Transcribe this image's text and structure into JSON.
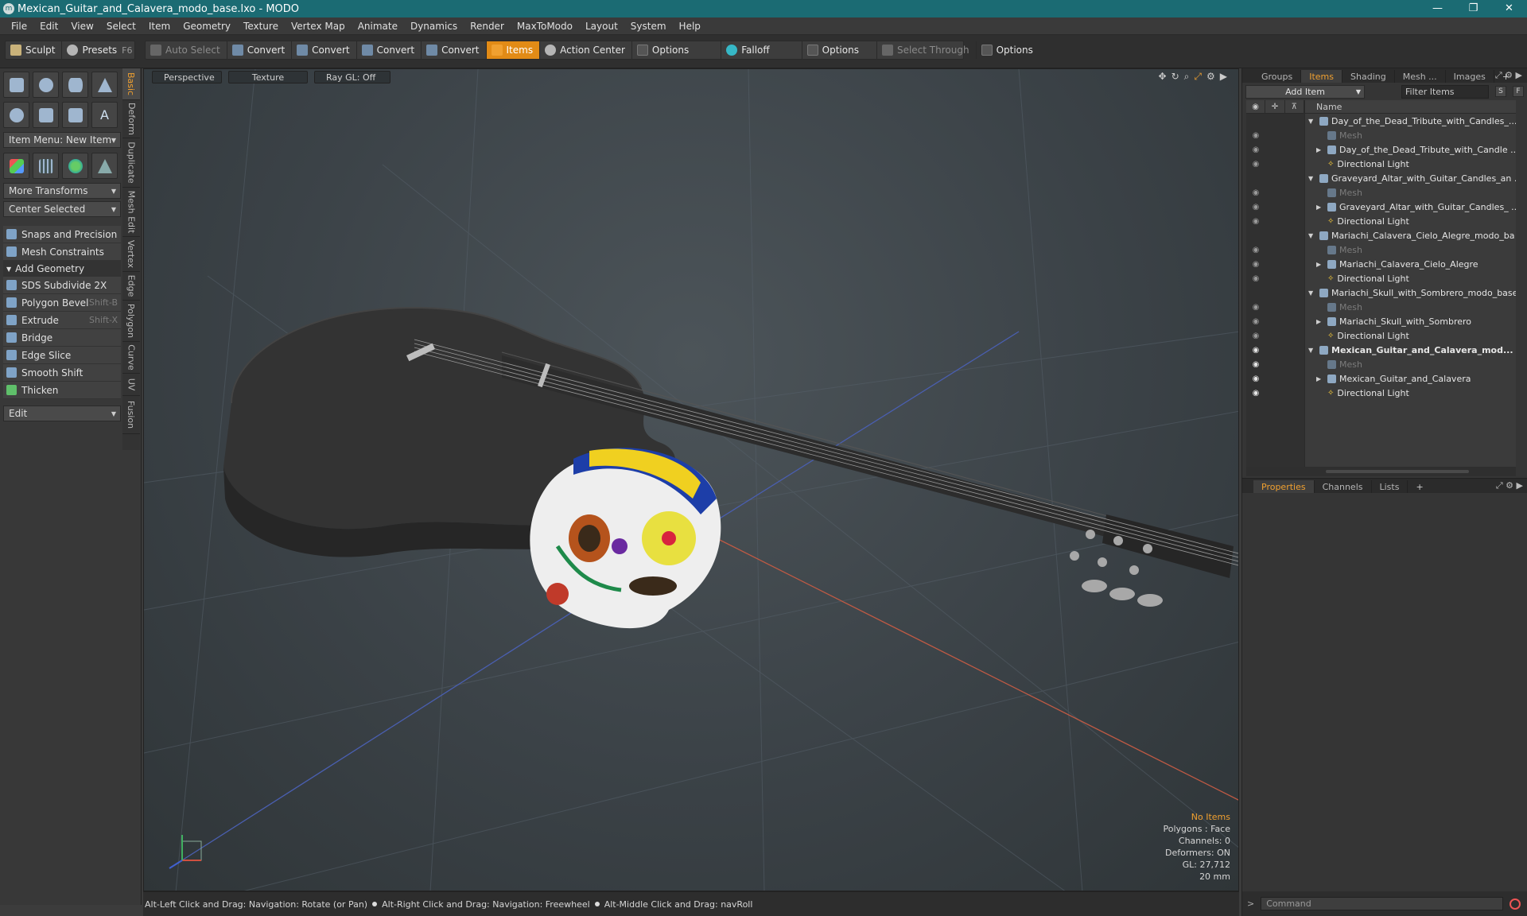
{
  "window": {
    "title": "Mexican_Guitar_and_Calavera_modo_base.lxo - MODO",
    "minimize": "—",
    "maximize": "❐",
    "close": "✕"
  },
  "menu": [
    "File",
    "Edit",
    "View",
    "Select",
    "Item",
    "Geometry",
    "Texture",
    "Vertex Map",
    "Animate",
    "Dynamics",
    "Render",
    "MaxToModo",
    "Layout",
    "System",
    "Help"
  ],
  "toolbar": {
    "sculpt": "Sculpt",
    "presets": "Presets",
    "presets_key": "F6",
    "auto_select": "Auto Select",
    "convert": [
      "Convert",
      "Convert",
      "Convert",
      "Convert"
    ],
    "items": "Items",
    "action_center": "Action Center",
    "options": [
      "Options",
      "Options",
      "Options"
    ],
    "falloff": "Falloff",
    "select_through": "Select Through"
  },
  "left": {
    "item_menu": "Item Menu: New Item",
    "more_transforms": "More Transforms",
    "center_selected": "Center Selected",
    "snaps": "Snaps and Precision",
    "mesh_constraints": "Mesh Constraints",
    "add_geometry": "Add Geometry",
    "tools": [
      {
        "label": "SDS Subdivide 2X",
        "key": ""
      },
      {
        "label": "Polygon Bevel",
        "key": "Shift-B"
      },
      {
        "label": "Extrude",
        "key": "Shift-X"
      },
      {
        "label": "Bridge",
        "key": ""
      },
      {
        "label": "Edge Slice",
        "key": ""
      },
      {
        "label": "Smooth Shift",
        "key": ""
      },
      {
        "label": "Thicken",
        "key": ""
      }
    ],
    "edit_dropdown": "Edit",
    "vtabs": [
      "Basic",
      "Deform",
      "Duplicate",
      "Mesh Edit",
      "Vertex",
      "Edge",
      "Polygon",
      "Curve",
      "UV",
      "Fusion"
    ]
  },
  "viewport": {
    "tabs": [
      "Perspective",
      "Texture",
      "Ray GL: Off"
    ],
    "info": {
      "selection": "No Items",
      "polygons": "Polygons : Face",
      "channels": "Channels: 0",
      "deformers": "Deformers: ON",
      "gl": "GL: 27,712",
      "scale": "20 mm"
    }
  },
  "status": {
    "hint1": "Alt-Left Click and Drag: Navigation: Rotate (or Pan)",
    "hint2": "Alt-Right Click and Drag: Navigation: Freewheel",
    "hint3": "Alt-Middle Click and Drag: navRoll"
  },
  "right": {
    "top_tabs": [
      "Groups",
      "Items",
      "Shading",
      "Mesh ...",
      "Images"
    ],
    "add_item": "Add Item",
    "filter": "Filter Items",
    "s_btn": "S",
    "f_btn": "F",
    "name_col": "Name",
    "tree": [
      {
        "label": "Day_of_the_Dead_Tribute_with_Candles_...",
        "kind": "scene",
        "depth": 0,
        "arrow": "▼",
        "eye": "",
        "bold": false
      },
      {
        "label": "Mesh",
        "kind": "mesh",
        "depth": 1,
        "arrow": "",
        "eye": "◉",
        "bold": false
      },
      {
        "label": "Day_of_the_Dead_Tribute_with_Candle ...",
        "kind": "group",
        "depth": 1,
        "arrow": "▶",
        "eye": "◉",
        "bold": false
      },
      {
        "label": "Directional Light",
        "kind": "light",
        "depth": 1,
        "arrow": "",
        "eye": "◉",
        "bold": false
      },
      {
        "label": "Graveyard_Altar_with_Guitar_Candles_an ...",
        "kind": "scene",
        "depth": 0,
        "arrow": "▼",
        "eye": "",
        "bold": false
      },
      {
        "label": "Mesh",
        "kind": "mesh",
        "depth": 1,
        "arrow": "",
        "eye": "◉",
        "bold": false
      },
      {
        "label": "Graveyard_Altar_with_Guitar_Candles_ ...",
        "kind": "group",
        "depth": 1,
        "arrow": "▶",
        "eye": "◉",
        "bold": false
      },
      {
        "label": "Directional Light",
        "kind": "light",
        "depth": 1,
        "arrow": "",
        "eye": "◉",
        "bold": false
      },
      {
        "label": "Mariachi_Calavera_Cielo_Alegre_modo_ba ...",
        "kind": "scene",
        "depth": 0,
        "arrow": "▼",
        "eye": "",
        "bold": false
      },
      {
        "label": "Mesh",
        "kind": "mesh",
        "depth": 1,
        "arrow": "",
        "eye": "◉",
        "bold": false
      },
      {
        "label": "Mariachi_Calavera_Cielo_Alegre",
        "kind": "group",
        "depth": 1,
        "arrow": "▶",
        "eye": "◉",
        "bold": false
      },
      {
        "label": "Directional Light",
        "kind": "light",
        "depth": 1,
        "arrow": "",
        "eye": "◉",
        "bold": false
      },
      {
        "label": "Mariachi_Skull_with_Sombrero_modo_base ...",
        "kind": "scene",
        "depth": 0,
        "arrow": "▼",
        "eye": "",
        "bold": false
      },
      {
        "label": "Mesh",
        "kind": "mesh",
        "depth": 1,
        "arrow": "",
        "eye": "◉",
        "bold": false
      },
      {
        "label": "Mariachi_Skull_with_Sombrero",
        "kind": "group",
        "depth": 1,
        "arrow": "▶",
        "eye": "◉",
        "bold": false
      },
      {
        "label": "Directional Light",
        "kind": "light",
        "depth": 1,
        "arrow": "",
        "eye": "◉",
        "bold": false
      },
      {
        "label": "Mexican_Guitar_and_Calavera_mod...",
        "kind": "scene",
        "depth": 0,
        "arrow": "▼",
        "eye": "◉",
        "bold": true
      },
      {
        "label": "Mesh",
        "kind": "mesh",
        "depth": 1,
        "arrow": "",
        "eye": "◉",
        "bold": false
      },
      {
        "label": "Mexican_Guitar_and_Calavera",
        "kind": "group",
        "depth": 1,
        "arrow": "▶",
        "eye": "◉",
        "bold": false
      },
      {
        "label": "Directional Light",
        "kind": "light",
        "depth": 1,
        "arrow": "",
        "eye": "◉",
        "bold": false
      }
    ],
    "bottom_tabs": [
      "Properties",
      "Channels",
      "Lists"
    ],
    "command_placeholder": "Command",
    "command_prompt": ">"
  },
  "colors": {
    "titlebar": "#1b6b73",
    "accent": "#e28b16"
  }
}
